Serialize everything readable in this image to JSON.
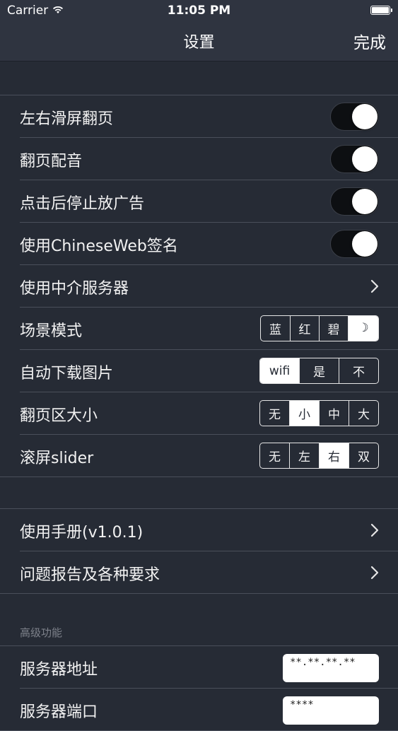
{
  "status": {
    "carrier": "Carrier",
    "time": "11:05 PM"
  },
  "nav": {
    "title": "设置",
    "done": "完成"
  },
  "toggles": [
    {
      "label": "左右滑屏翻页",
      "on": true
    },
    {
      "label": "翻页配音",
      "on": true
    },
    {
      "label": "点击后停止放广告",
      "on": true
    },
    {
      "label": "使用ChineseWeb签名",
      "on": true
    }
  ],
  "proxy": {
    "label": "使用中介服务器"
  },
  "segments": [
    {
      "label": "场景模式",
      "options": [
        "蓝",
        "红",
        "碧",
        "☽"
      ],
      "selected": "☽"
    },
    {
      "label": "自动下载图片",
      "options": [
        "wifi",
        "是",
        "不"
      ],
      "selected": "wifi"
    },
    {
      "label": "翻页区大小",
      "options": [
        "无",
        "小",
        "中",
        "大"
      ],
      "selected": "小"
    },
    {
      "label": "滚屏slider",
      "options": [
        "无",
        "左",
        "右",
        "双"
      ],
      "selected": "右"
    }
  ],
  "links": [
    {
      "label": "使用手册(v1.0.1)"
    },
    {
      "label": "问题报告及各种要求"
    }
  ],
  "advanced": {
    "header": "高级功能",
    "server_label": "服务器地址",
    "server_value": "**.**.**.**",
    "port_label": "服务器端口",
    "port_value": "****"
  }
}
